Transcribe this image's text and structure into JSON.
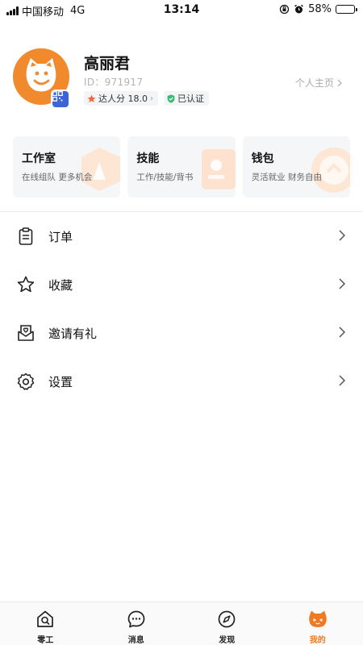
{
  "status_bar": {
    "carrier": "中国移动",
    "network": "4G",
    "time": "13:14",
    "battery": "58%",
    "battery_level": 0.58
  },
  "profile": {
    "name": "高丽君",
    "id_text": "ID：971917",
    "score_label": "达人分 18.0",
    "verified_label": "已认证",
    "homepage_label": "个人主页"
  },
  "cards": [
    {
      "title": "工作室",
      "subtitle": "在线组队 更多机会"
    },
    {
      "title": "技能",
      "subtitle": "工作/技能/背书"
    },
    {
      "title": "钱包",
      "subtitle": "灵活就业 财务自由"
    }
  ],
  "menu": [
    {
      "label": "订单",
      "icon": "clipboard-icon"
    },
    {
      "label": "收藏",
      "icon": "star-icon"
    },
    {
      "label": "邀请有礼",
      "icon": "gift-envelope-icon"
    },
    {
      "label": "设置",
      "icon": "gear-icon"
    }
  ],
  "tabs": [
    {
      "label": "零工",
      "icon": "home-search-icon"
    },
    {
      "label": "消息",
      "icon": "chat-bubble-icon"
    },
    {
      "label": "发现",
      "icon": "compass-icon"
    },
    {
      "label": "我的",
      "icon": "cat-face-icon"
    }
  ],
  "colors": {
    "accent": "#f07a22",
    "avatar_bg": "#f08a2c",
    "qr_badge": "#3d63d9",
    "verified": "#3cb878",
    "score_star": "#f06a3a"
  }
}
